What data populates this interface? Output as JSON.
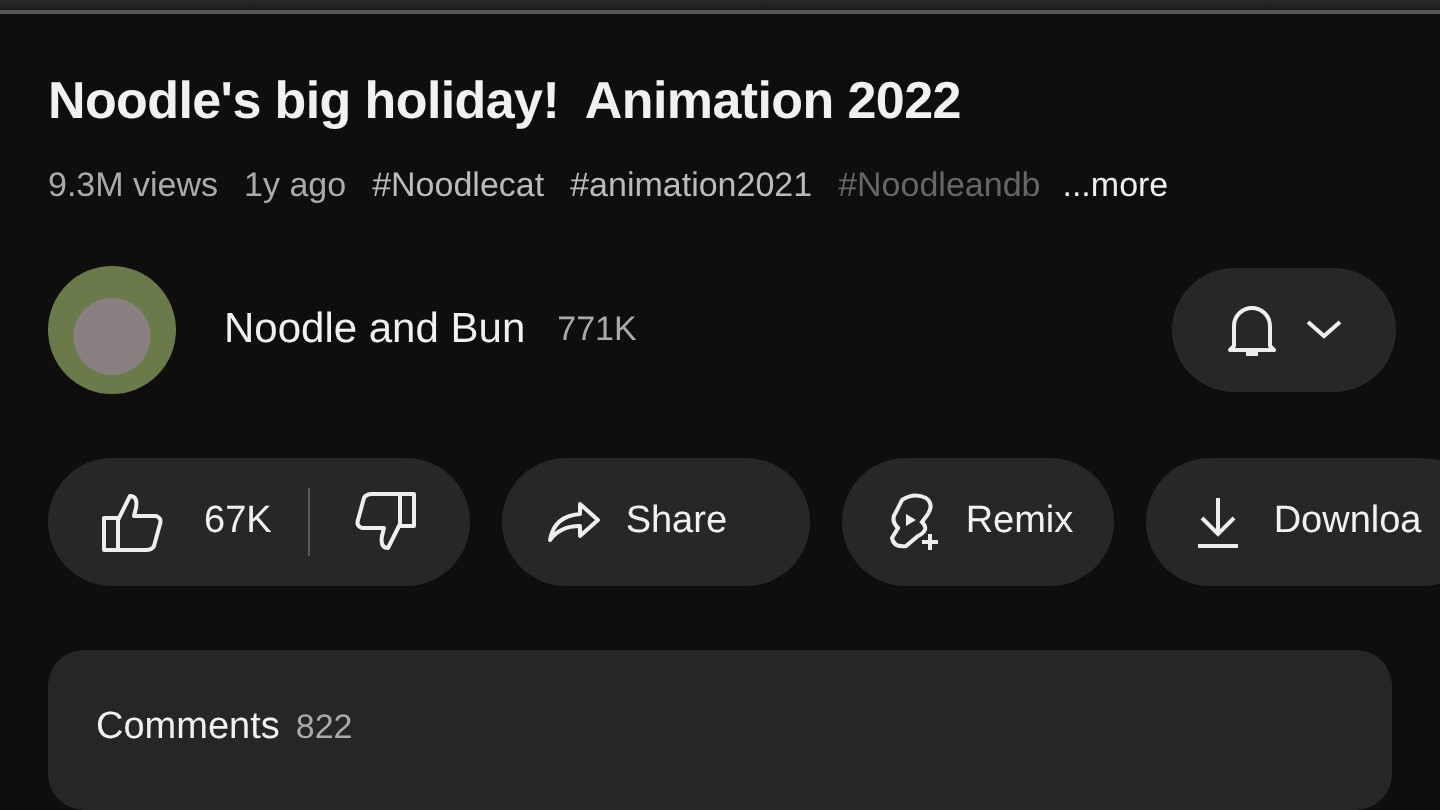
{
  "video": {
    "title": "Noodle's big holiday!  Animation 2022"
  },
  "meta": {
    "views": "9.3M views",
    "age": "1y ago",
    "hashtags": [
      {
        "text": "#Noodlecat",
        "faded": false
      },
      {
        "text": "#animation2021",
        "faded": false
      },
      {
        "text": "#Noodleandb",
        "faded": true
      }
    ],
    "more": "...more"
  },
  "channel": {
    "name": "Noodle and Bun",
    "subscribers": "771K"
  },
  "actions": [
    {
      "kind": "like",
      "likes": "67K"
    },
    {
      "kind": "share",
      "label": "Share"
    },
    {
      "kind": "remix",
      "label": "Remix"
    },
    {
      "kind": "download",
      "label": "Downloa"
    }
  ],
  "comments": {
    "label": "Comments",
    "count": "822"
  }
}
